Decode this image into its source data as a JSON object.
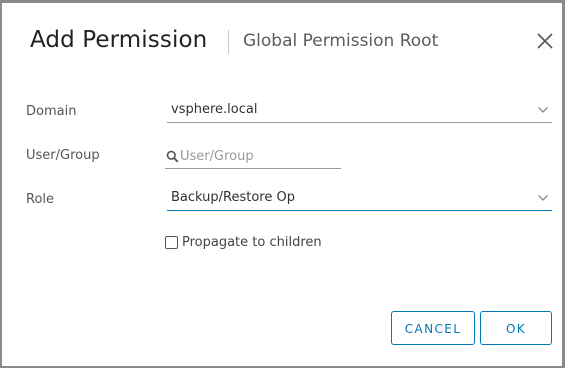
{
  "dialog": {
    "title": "Add Permission",
    "subtitle": "Global Permission Root",
    "close_icon": "close-icon"
  },
  "form": {
    "domain": {
      "label": "Domain",
      "value": "vsphere.local"
    },
    "user_group": {
      "label": "User/Group",
      "value": "",
      "placeholder": "User/Group",
      "icon": "search-icon"
    },
    "role": {
      "label": "Role",
      "value": "Backup/Restore Op"
    },
    "propagate": {
      "label": "Propagate to children",
      "checked": false
    }
  },
  "footer": {
    "cancel_label": "CANCEL",
    "ok_label": "OK"
  },
  "colors": {
    "accent": "#0079b8",
    "backdrop": "#8a8a8a",
    "dialog_background": "#ffffff"
  }
}
